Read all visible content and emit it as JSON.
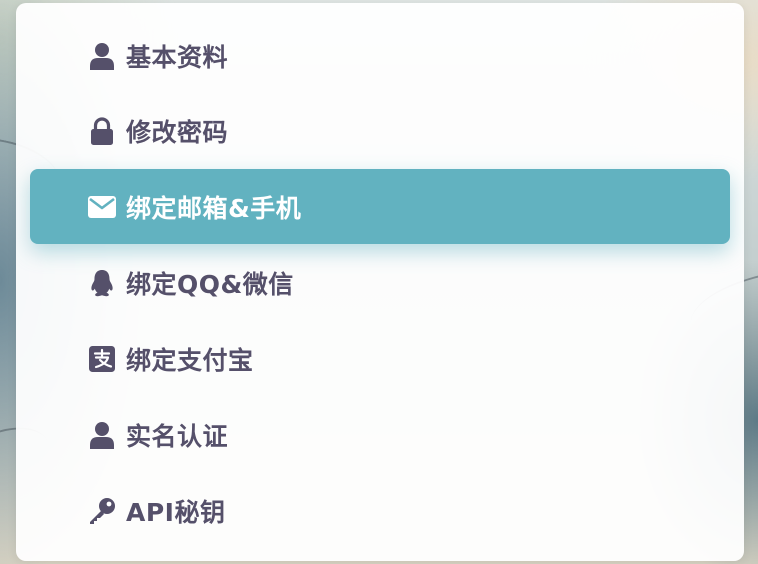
{
  "menu": {
    "active_index": 2,
    "colors": {
      "text": "#55506a",
      "active_bg": "#62b2c0",
      "active_text": "#ffffff"
    },
    "items": [
      {
        "label": "基本资料",
        "icon": "user-icon"
      },
      {
        "label": "修改密码",
        "icon": "lock-icon"
      },
      {
        "label": "绑定邮箱&手机",
        "icon": "envelope-icon"
      },
      {
        "label": "绑定QQ&微信",
        "icon": "qq-icon"
      },
      {
        "label": "绑定支付宝",
        "icon": "alipay-icon"
      },
      {
        "label": "实名认证",
        "icon": "user-icon"
      },
      {
        "label": "API秘钥",
        "icon": "key-icon"
      }
    ]
  }
}
